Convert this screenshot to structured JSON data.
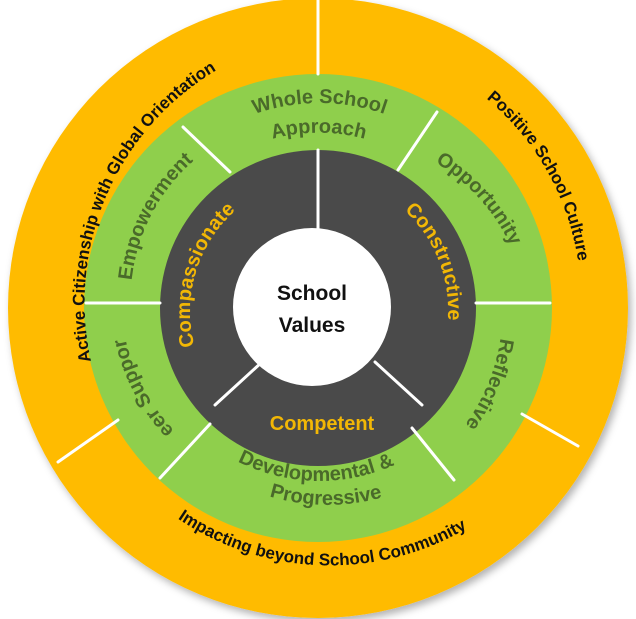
{
  "colors": {
    "outer_ring": "#ffbb00",
    "middle_ring": "#8fcf4c",
    "inner_ring": "#4a4a4a",
    "center": "#ffffff",
    "divider": "#ffffff",
    "outer_text": "#111111",
    "middle_text": "#4a6a2a",
    "inner_text": "#f2b705",
    "center_text": "#111111"
  },
  "center": {
    "line1": "School",
    "line2": "Values"
  },
  "inner_ring": {
    "segments": [
      {
        "label": "Compassionate"
      },
      {
        "label": "Constructive"
      },
      {
        "label": "Competent"
      }
    ]
  },
  "middle_ring": {
    "segments": [
      {
        "line1": "Whole School",
        "line2": "Approach"
      },
      {
        "line1": "Opportunity",
        "line2": ""
      },
      {
        "line1": "Reflective",
        "line2": ""
      },
      {
        "line1": "Developmental &",
        "line2": "Progressive"
      },
      {
        "line1": "Peer Support",
        "line2": ""
      },
      {
        "line1": "Empowerment",
        "line2": ""
      }
    ]
  },
  "outer_ring": {
    "segments": [
      {
        "label": "Active Citizenship with Global Orientation"
      },
      {
        "label": "Positive School Culture"
      },
      {
        "label": "Impacting beyond School Community"
      }
    ]
  }
}
